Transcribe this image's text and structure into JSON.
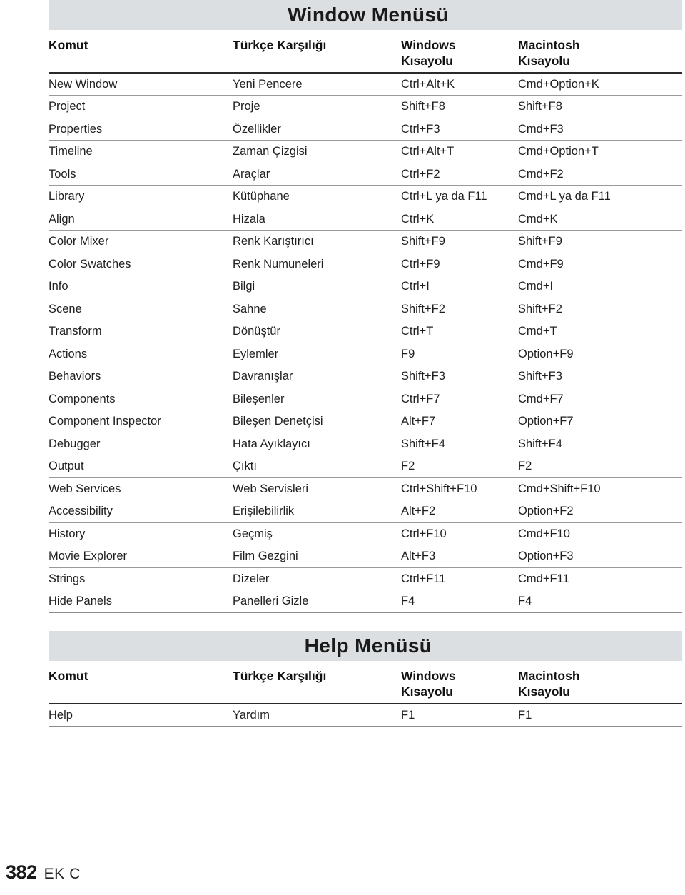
{
  "document": {
    "footer": {
      "page_number": "382",
      "label": "EK C"
    }
  },
  "sections": [
    {
      "id": "window-menu",
      "title": "Window Menüsü",
      "columns": [
        {
          "key": "command",
          "label": "Komut"
        },
        {
          "key": "turkish",
          "label": "Türkçe Karşılığı"
        },
        {
          "key": "windows",
          "label": "Windows\nKısayolu"
        },
        {
          "key": "mac",
          "label": "Macintosh\nKısayolu"
        }
      ],
      "rows": [
        {
          "command": "New Window",
          "turkish": "Yeni Pencere",
          "windows": "Ctrl+Alt+K",
          "mac": "Cmd+Option+K"
        },
        {
          "command": "Project",
          "turkish": "Proje",
          "windows": "Shift+F8",
          "mac": "Shift+F8"
        },
        {
          "command": "Properties",
          "turkish": "Özellikler",
          "windows": "Ctrl+F3",
          "mac": "Cmd+F3"
        },
        {
          "command": "Timeline",
          "turkish": "Zaman Çizgisi",
          "windows": "Ctrl+Alt+T",
          "mac": "Cmd+Option+T"
        },
        {
          "command": "Tools",
          "turkish": "Araçlar",
          "windows": "Ctrl+F2",
          "mac": "Cmd+F2"
        },
        {
          "command": "Library",
          "turkish": "Kütüphane",
          "windows": "Ctrl+L ya da F11",
          "mac": "Cmd+L ya da F11"
        },
        {
          "command": "Align",
          "turkish": "Hizala",
          "windows": "Ctrl+K",
          "mac": "Cmd+K"
        },
        {
          "command": "Color Mixer",
          "turkish": "Renk Karıştırıcı",
          "windows": "Shift+F9",
          "mac": "Shift+F9"
        },
        {
          "command": "Color Swatches",
          "turkish": "Renk Numuneleri",
          "windows": "Ctrl+F9",
          "mac": "Cmd+F9"
        },
        {
          "command": "Info",
          "turkish": "Bilgi",
          "windows": "Ctrl+I",
          "mac": "Cmd+I"
        },
        {
          "command": "Scene",
          "turkish": "Sahne",
          "windows": "Shift+F2",
          "mac": "Shift+F2"
        },
        {
          "command": "Transform",
          "turkish": "Dönüştür",
          "windows": "Ctrl+T",
          "mac": "Cmd+T"
        },
        {
          "command": "Actions",
          "turkish": "Eylemler",
          "windows": "F9",
          "mac": "Option+F9"
        },
        {
          "command": "Behaviors",
          "turkish": "Davranışlar",
          "windows": "Shift+F3",
          "mac": "Shift+F3"
        },
        {
          "command": "Components",
          "turkish": "Bileşenler",
          "windows": "Ctrl+F7",
          "mac": "Cmd+F7"
        },
        {
          "command": "Component Inspector",
          "turkish": "Bileşen Denetçisi",
          "windows": "Alt+F7",
          "mac": "Option+F7"
        },
        {
          "command": "Debugger",
          "turkish": "Hata Ayıklayıcı",
          "windows": "Shift+F4",
          "mac": "Shift+F4"
        },
        {
          "command": "Output",
          "turkish": "Çıktı",
          "windows": "F2",
          "mac": "F2"
        },
        {
          "command": "Web Services",
          "turkish": "Web Servisleri",
          "windows": "Ctrl+Shift+F10",
          "mac": "Cmd+Shift+F10"
        },
        {
          "command": "Accessibility",
          "turkish": "Erişilebilirlik",
          "windows": "Alt+F2",
          "mac": "Option+F2"
        },
        {
          "command": "History",
          "turkish": "Geçmiş",
          "windows": "Ctrl+F10",
          "mac": "Cmd+F10"
        },
        {
          "command": "Movie Explorer",
          "turkish": "Film Gezgini",
          "windows": "Alt+F3",
          "mac": "Option+F3"
        },
        {
          "command": "Strings",
          "turkish": "Dizeler",
          "windows": "Ctrl+F11",
          "mac": "Cmd+F11"
        },
        {
          "command": "Hide Panels",
          "turkish": "Panelleri Gizle",
          "windows": "F4",
          "mac": "F4"
        }
      ]
    },
    {
      "id": "help-menu",
      "title": "Help Menüsü",
      "columns": [
        {
          "key": "command",
          "label": "Komut"
        },
        {
          "key": "turkish",
          "label": "Türkçe Karşılığı"
        },
        {
          "key": "windows",
          "label": "Windows\nKısayolu"
        },
        {
          "key": "mac",
          "label": "Macintosh\nKısayolu"
        }
      ],
      "rows": [
        {
          "command": "Help",
          "turkish": "Yardım",
          "windows": "F1",
          "mac": "F1"
        }
      ]
    }
  ],
  "colors": {
    "band_background": "#dcdfe1",
    "text": "#1a1a1a",
    "rule": "#9a9a9a",
    "header_rule": "#2a2a2a"
  }
}
